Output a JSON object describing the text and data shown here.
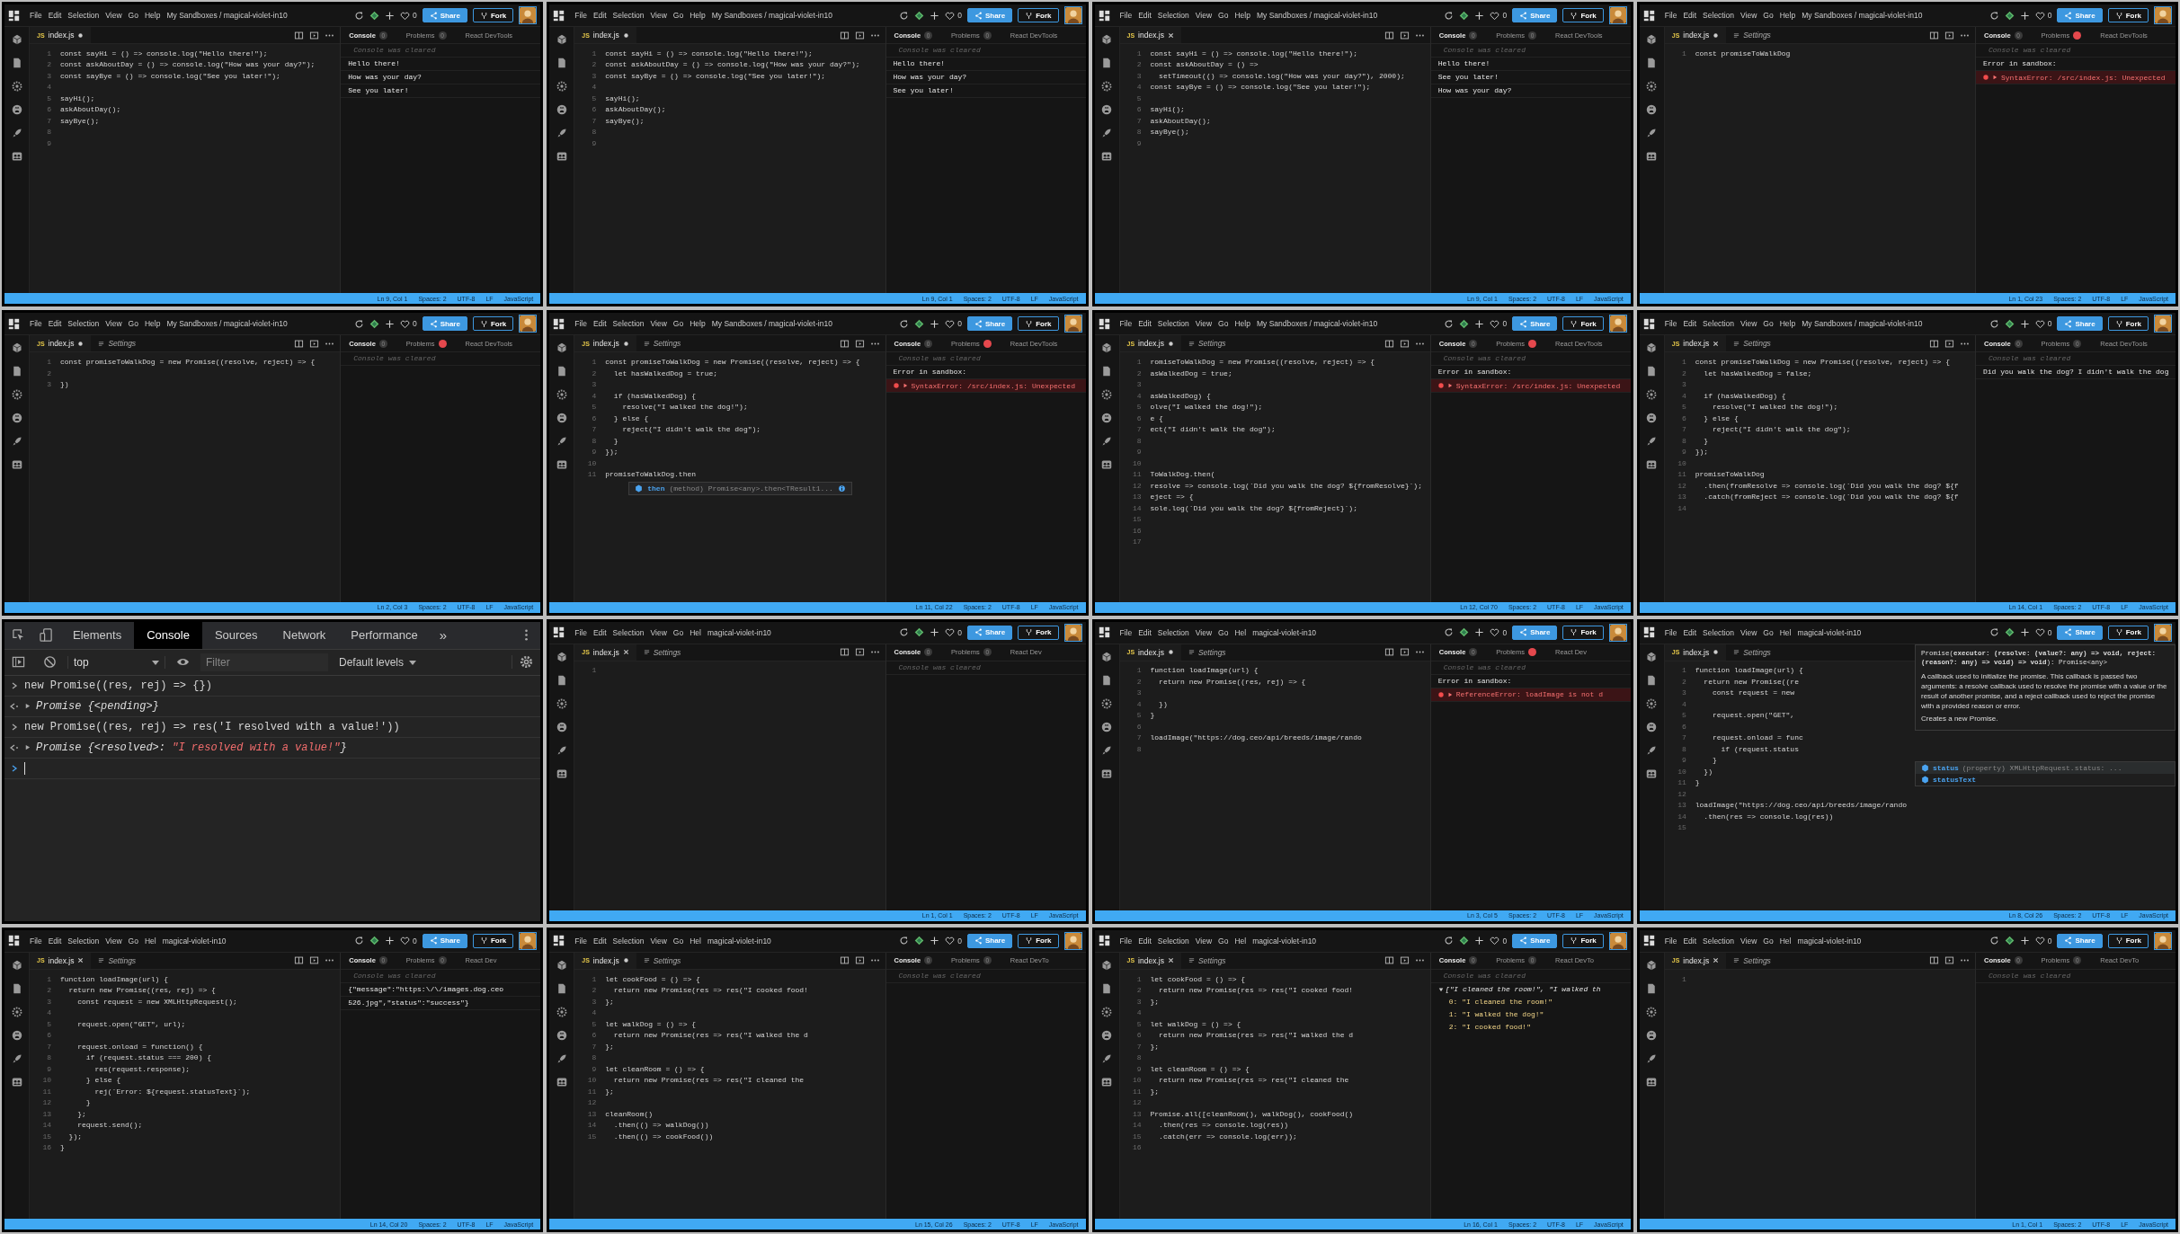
{
  "tiles": [
    {
      "kind": "editor",
      "menu": [
        "File",
        "Edit",
        "Selection",
        "View",
        "Go",
        "Help"
      ],
      "title": "My Sandboxes / magical-violet-in10",
      "likes": "0",
      "share": "Share",
      "fork": "Fork",
      "tabs": [
        {
          "kind": "file",
          "badge": "JS",
          "label": "index.js",
          "modified": true,
          "selected": true
        }
      ],
      "lines": [
        {
          "number": "1",
          "code": "const sayHi = () => console.log(\"Hello there!\");"
        },
        {
          "number": "2",
          "code": "const askAboutDay = () => console.log(\"How was your day?\");"
        },
        {
          "number": "3",
          "code": "const sayBye = () => console.log(\"See you later!\");"
        },
        {
          "number": "4"
        },
        {
          "number": "5",
          "code": "sayHi();"
        },
        {
          "number": "6",
          "code": "askAboutDay();"
        },
        {
          "number": "7",
          "code": "sayBye();"
        },
        {
          "number": "8"
        },
        {
          "number": "9"
        }
      ],
      "consoleTabs": [
        {
          "label": "Console",
          "count": "0",
          "error": false,
          "selected": true
        },
        {
          "label": "Problems",
          "count": "0",
          "error": false,
          "selected": false
        },
        {
          "label": "React DevTools",
          "selected": false
        }
      ],
      "console": [
        {
          "kind": "cleared",
          "text": "Console was cleared"
        },
        {
          "kind": "log",
          "text": "Hello there!"
        },
        {
          "kind": "log",
          "text": "How was your day?"
        },
        {
          "kind": "log",
          "text": "See you later!"
        }
      ],
      "status": [
        "Ln 9, Col 1",
        "Spaces: 2",
        "UTF-8",
        "LF",
        "JavaScript"
      ]
    },
    {
      "kind": "editor",
      "menu": [
        "File",
        "Edit",
        "Selection",
        "View",
        "Go",
        "Help"
      ],
      "title": "My Sandboxes / magical-violet-in10",
      "likes": "0",
      "share": "Share",
      "fork": "Fork",
      "tabs": [
        {
          "kind": "file",
          "badge": "JS",
          "label": "index.js",
          "modified": true,
          "selected": true
        }
      ],
      "lines": [
        {
          "number": "1",
          "code": "const sayHi = () => console.log(\"Hello there!\");"
        },
        {
          "number": "2",
          "code": "const askAboutDay = () => console.log(\"How was your day?\");"
        },
        {
          "number": "3",
          "code": "const sayBye = () => console.log(\"See you later!\");"
        },
        {
          "number": "4"
        },
        {
          "number": "5",
          "code": "sayHi();"
        },
        {
          "number": "6",
          "code": "askAboutDay();"
        },
        {
          "number": "7",
          "code": "sayBye();"
        },
        {
          "number": "8"
        },
        {
          "number": "9"
        }
      ],
      "consoleTabs": [
        {
          "label": "Console",
          "count": "0",
          "error": false,
          "selected": true
        },
        {
          "label": "Problems",
          "count": "0",
          "error": false,
          "selected": false
        },
        {
          "label": "React DevTools",
          "selected": false
        }
      ],
      "console": [
        {
          "kind": "cleared",
          "text": "Console was cleared"
        },
        {
          "kind": "log",
          "text": "Hello there!"
        },
        {
          "kind": "log",
          "text": "How was your day?"
        },
        {
          "kind": "log",
          "text": "See you later!"
        }
      ],
      "status": [
        "Ln 9, Col 1",
        "Spaces: 2",
        "UTF-8",
        "LF",
        "JavaScript"
      ]
    },
    {
      "kind": "editor",
      "menu": [
        "File",
        "Edit",
        "Selection",
        "View",
        "Go",
        "Help"
      ],
      "title": "My Sandboxes / magical-violet-in10",
      "likes": "0",
      "share": "Share",
      "fork": "Fork",
      "tabs": [
        {
          "kind": "file",
          "badge": "JS",
          "label": "index.js",
          "modified": false,
          "selected": true
        }
      ],
      "lines": [
        {
          "number": "1",
          "code": "const sayHi = () => console.log(\"Hello there!\");"
        },
        {
          "number": "2",
          "code": "const askAboutDay = () =>"
        },
        {
          "number": "3",
          "code": "  setTimeout(() => console.log(\"How was your day?\"), 2000);"
        },
        {
          "number": "4",
          "code": "const sayBye = () => console.log(\"See you later!\");"
        },
        {
          "number": "5"
        },
        {
          "number": "6",
          "code": "sayHi();"
        },
        {
          "number": "7",
          "code": "askAboutDay();"
        },
        {
          "number": "8",
          "code": "sayBye();"
        },
        {
          "number": "9"
        }
      ],
      "consoleTabs": [
        {
          "label": "Console",
          "count": "0",
          "error": false,
          "selected": true
        },
        {
          "label": "Problems",
          "count": "0",
          "error": false,
          "selected": false
        },
        {
          "label": "React DevTools",
          "selected": false
        }
      ],
      "console": [
        {
          "kind": "cleared",
          "text": "Console was cleared"
        },
        {
          "kind": "log",
          "text": "Hello there!"
        },
        {
          "kind": "log",
          "text": "See you later!"
        },
        {
          "kind": "log",
          "text": "How was your day?"
        }
      ],
      "status": [
        "Ln 9, Col 1",
        "Spaces: 2",
        "UTF-8",
        "LF",
        "JavaScript"
      ]
    },
    {
      "kind": "editor",
      "menu": [
        "File",
        "Edit",
        "Selection",
        "View",
        "Go",
        "Help"
      ],
      "title": "My Sandboxes / magical-violet-in10",
      "likes": "0",
      "share": "Share",
      "fork": "Fork",
      "tabs": [
        {
          "kind": "file",
          "badge": "JS",
          "label": "index.js",
          "modified": true,
          "selected": true
        },
        {
          "kind": "settings",
          "label": "Settings",
          "selected": false
        }
      ],
      "lines": [
        {
          "number": "1",
          "code": "const promiseToWalkDog"
        }
      ],
      "consoleTabs": [
        {
          "label": "Console",
          "count": "0",
          "error": false,
          "selected": true
        },
        {
          "label": "Problems",
          "error": true,
          "selected": false
        },
        {
          "label": "React DevTools",
          "selected": false
        }
      ],
      "console": [
        {
          "kind": "cleared",
          "text": "Console was cleared"
        },
        {
          "kind": "error-title",
          "text": "Error in sandbox:"
        },
        {
          "kind": "error",
          "text": "SyntaxError: /src/index.js: Unexpected"
        }
      ],
      "status": [
        "Ln 1, Col 23",
        "Spaces: 2",
        "UTF-8",
        "LF",
        "JavaScript"
      ]
    },
    {
      "kind": "editor",
      "menu": [
        "File",
        "Edit",
        "Selection",
        "View",
        "Go",
        "Help"
      ],
      "title": "My Sandboxes / magical-violet-in10",
      "likes": "0",
      "share": "Share",
      "fork": "Fork",
      "tabs": [
        {
          "kind": "file",
          "badge": "JS",
          "label": "index.js",
          "modified": true,
          "selected": true
        },
        {
          "kind": "settings",
          "label": "Settings",
          "selected": false
        }
      ],
      "lines": [
        {
          "number": "1",
          "code": "const promiseToWalkDog = new Promise((resolve, reject) => {"
        },
        {
          "number": "2"
        },
        {
          "number": "3",
          "code": "})"
        }
      ],
      "consoleTabs": [
        {
          "label": "Console",
          "count": "0",
          "error": false,
          "selected": true
        },
        {
          "label": "Problems",
          "error": true,
          "selected": false
        },
        {
          "label": "React DevTools",
          "selected": false
        }
      ],
      "console": [
        {
          "kind": "cleared",
          "text": "Console was cleared"
        }
      ],
      "status": [
        "Ln 2, Col 3",
        "Spaces: 2",
        "UTF-8",
        "LF",
        "JavaScript"
      ]
    },
    {
      "kind": "editor",
      "menu": [
        "File",
        "Edit",
        "Selection",
        "View",
        "Go",
        "Help"
      ],
      "title": "My Sandboxes / magical-violet-in10",
      "likes": "0",
      "share": "Share",
      "fork": "Fork",
      "tabs": [
        {
          "kind": "file",
          "badge": "JS",
          "label": "index.js",
          "modified": true,
          "selected": true
        },
        {
          "kind": "settings",
          "label": "Settings",
          "selected": false
        }
      ],
      "lines": [
        {
          "number": "1",
          "code": "const promiseToWalkDog = new Promise((resolve, reject) => {"
        },
        {
          "number": "2",
          "code": "  let hasWalkedDog = true;"
        },
        {
          "number": "3"
        },
        {
          "number": "4",
          "code": "  if (hasWalkedDog) {"
        },
        {
          "number": "5",
          "code": "    resolve(\"I walked the dog!\");"
        },
        {
          "number": "6",
          "code": "  } else {"
        },
        {
          "number": "7",
          "code": "    reject(\"I didn't walk the dog\");"
        },
        {
          "number": "8",
          "code": "  }"
        },
        {
          "number": "9",
          "code": "});"
        },
        {
          "number": "10"
        },
        {
          "number": "11",
          "code": "promiseToWalkDog.then"
        }
      ],
      "autocomplete": {
        "label": "then",
        "detail": "(method) Promise<any>.then<TResult1..."
      },
      "consoleTabs": [
        {
          "label": "Console",
          "count": "0",
          "error": false,
          "selected": true
        },
        {
          "label": "Problems",
          "error": true,
          "selected": false
        },
        {
          "label": "React DevTools",
          "selected": false
        }
      ],
      "console": [
        {
          "kind": "cleared",
          "text": "Console was cleared"
        },
        {
          "kind": "error-title",
          "text": "Error in sandbox:"
        },
        {
          "kind": "error",
          "text": "SyntaxError: /src/index.js: Unexpected"
        }
      ],
      "status": [
        "Ln 11, Col 22",
        "Spaces: 2",
        "UTF-8",
        "LF",
        "JavaScript"
      ]
    },
    {
      "kind": "editor",
      "menu": [
        "File",
        "Edit",
        "Selection",
        "View",
        "Go",
        "Help"
      ],
      "title": "My Sandboxes / magical-violet-in10",
      "likes": "0",
      "share": "Share",
      "fork": "Fork",
      "tabs": [
        {
          "kind": "file",
          "badge": "JS",
          "label": "index.js",
          "modified": true,
          "selected": true
        },
        {
          "kind": "settings",
          "label": "Settings",
          "selected": false
        }
      ],
      "lines": [
        {
          "number": "1",
          "code": "romiseToWalkDog = new Promise((resolve, reject) => {"
        },
        {
          "number": "2",
          "code": "asWalkedDog = true;"
        },
        {
          "number": "3"
        },
        {
          "number": "4",
          "code": "asWalkedDog) {"
        },
        {
          "number": "5",
          "code": "olve(\"I walked the dog!\");"
        },
        {
          "number": "6",
          "code": "e {"
        },
        {
          "number": "7",
          "code": "ect(\"I didn't walk the dog\");"
        },
        {
          "number": "8"
        },
        {
          "number": "9"
        },
        {
          "number": "10"
        },
        {
          "number": "11",
          "code": "ToWalkDog.then("
        },
        {
          "number": "12",
          "code": "resolve => console.log(`Did you walk the dog? ${fromResolve}`);"
        },
        {
          "number": "13",
          "code": "eject => {"
        },
        {
          "number": "14",
          "code": "sole.log(`Did you walk the dog? ${fromReject}`);"
        },
        {
          "number": "15"
        },
        {
          "number": "16"
        },
        {
          "number": "17"
        }
      ],
      "consoleTabs": [
        {
          "label": "Console",
          "count": "0",
          "error": false,
          "selected": true
        },
        {
          "label": "Problems",
          "error": true,
          "selected": false
        },
        {
          "label": "React DevTools",
          "selected": false
        }
      ],
      "console": [
        {
          "kind": "cleared",
          "text": "Console was cleared"
        },
        {
          "kind": "error-title",
          "text": "Error in sandbox:"
        },
        {
          "kind": "error",
          "text": "SyntaxError: /src/index.js: Unexpected"
        }
      ],
      "status": [
        "Ln 12, Col 70",
        "Spaces: 2",
        "UTF-8",
        "LF",
        "JavaScript"
      ]
    },
    {
      "kind": "editor",
      "menu": [
        "File",
        "Edit",
        "Selection",
        "View",
        "Go",
        "Help"
      ],
      "title": "My Sandboxes / magical-violet-in10",
      "likes": "0",
      "share": "Share",
      "fork": "Fork",
      "tabs": [
        {
          "kind": "file",
          "badge": "JS",
          "label": "index.js",
          "modified": false,
          "selected": true
        },
        {
          "kind": "settings",
          "label": "Settings",
          "selected": false
        }
      ],
      "lines": [
        {
          "number": "1",
          "code": "const promiseToWalkDog = new Promise((resolve, reject) => {"
        },
        {
          "number": "2",
          "code": "  let hasWalkedDog = false;"
        },
        {
          "number": "3"
        },
        {
          "number": "4",
          "code": "  if (hasWalkedDog) {"
        },
        {
          "number": "5",
          "code": "    resolve(\"I walked the dog!\");"
        },
        {
          "number": "6",
          "code": "  } else {"
        },
        {
          "number": "7",
          "code": "    reject(\"I didn't walk the dog\");"
        },
        {
          "number": "8",
          "code": "  }"
        },
        {
          "number": "9",
          "code": "});"
        },
        {
          "number": "10"
        },
        {
          "number": "11",
          "code": "promiseToWalkDog"
        },
        {
          "number": "12",
          "code": "  .then(fromResolve => console.log(`Did you walk the dog? ${f"
        },
        {
          "number": "13",
          "code": "  .catch(fromReject => console.log(`Did you walk the dog? ${f"
        },
        {
          "number": "14"
        }
      ],
      "consoleTabs": [
        {
          "label": "Console",
          "count": "0",
          "error": false,
          "selected": true
        },
        {
          "label": "Problems",
          "count": "0",
          "error": false,
          "selected": false
        },
        {
          "label": "React DevTools",
          "selected": false
        }
      ],
      "console": [
        {
          "kind": "cleared",
          "text": "Console was cleared"
        },
        {
          "kind": "log",
          "text": "Did you walk the dog? I didn't walk the dog"
        }
      ],
      "status": [
        "Ln 14, Col 1",
        "Spaces: 2",
        "UTF-8",
        "LF",
        "JavaScript"
      ]
    },
    {
      "kind": "devtools",
      "tabs": [
        {
          "label": "Elements",
          "selected": false
        },
        {
          "label": "Console",
          "selected": true
        },
        {
          "label": "Sources",
          "selected": false
        },
        {
          "label": "Network",
          "selected": false
        },
        {
          "label": "Performance",
          "selected": false
        }
      ],
      "overflow": "»",
      "context": "top",
      "filter": {
        "placeholder": "Filter"
      },
      "levels": "Default levels",
      "entries": [
        {
          "kind": "input",
          "text": "new Promise((res, rej) => {})"
        },
        {
          "kind": "output",
          "text": "Promise {<pending>}"
        },
        {
          "kind": "input",
          "text": "new Promise((res, rej) => res('I resolved with a value!'))"
        },
        {
          "kind": "output",
          "text": "Promise {<resolved>: ",
          "value": "\"I resolved with a value!\"",
          "suffix": "}"
        }
      ]
    },
    {
      "kind": "editor",
      "menu": [
        "File",
        "Edit",
        "Selection",
        "View",
        "Go",
        "Hel"
      ],
      "title": "magical-violet-in10",
      "likes": "0",
      "share": "Share",
      "fork": "Fork",
      "tabs": [
        {
          "kind": "file",
          "badge": "JS",
          "label": "index.js",
          "modified": false,
          "selected": true
        },
        {
          "kind": "settings",
          "label": "Settings",
          "selected": false
        }
      ],
      "lines": [
        {
          "number": "1"
        }
      ],
      "consoleTabs": [
        {
          "label": "Console",
          "count": "0",
          "error": false,
          "selected": true
        },
        {
          "label": "Problems",
          "count": "0",
          "error": false,
          "selected": false
        },
        {
          "label": "React Dev",
          "selected": false
        }
      ],
      "console": [
        {
          "kind": "cleared",
          "text": "Console was cleared"
        }
      ],
      "status": [
        "Ln 1, Col 1",
        "Spaces: 2",
        "UTF-8",
        "LF",
        "JavaScript"
      ]
    },
    {
      "kind": "editor",
      "menu": [
        "File",
        "Edit",
        "Selection",
        "View",
        "Go",
        "Hel"
      ],
      "title": "magical-violet-in10",
      "likes": "0",
      "share": "Share",
      "fork": "Fork",
      "tabs": [
        {
          "kind": "file",
          "badge": "JS",
          "label": "index.js",
          "modified": true,
          "selected": true
        },
        {
          "kind": "settings",
          "label": "Settings",
          "selected": false
        }
      ],
      "lines": [
        {
          "number": "1",
          "code": "function loadImage(url) {"
        },
        {
          "number": "2",
          "code": "  return new Promise((res, rej) => {"
        },
        {
          "number": "3"
        },
        {
          "number": "4",
          "code": "  })"
        },
        {
          "number": "5",
          "code": "}"
        },
        {
          "number": "6"
        },
        {
          "number": "7",
          "code": "loadImage(\"https://dog.ceo/api/breeds/image/rando"
        },
        {
          "number": "8"
        }
      ],
      "consoleTabs": [
        {
          "label": "Console",
          "count": "0",
          "error": false,
          "selected": true
        },
        {
          "label": "Problems",
          "error": true,
          "selected": false
        },
        {
          "label": "React Dev",
          "selected": false
        }
      ],
      "console": [
        {
          "kind": "cleared",
          "text": "Console was cleared"
        },
        {
          "kind": "error-title",
          "text": "Error in sandbox:"
        },
        {
          "kind": "error",
          "text": "ReferenceError: loadImage is not d"
        }
      ],
      "status": [
        "Ln 3, Col 5",
        "Spaces: 2",
        "UTF-8",
        "LF",
        "JavaScript"
      ]
    },
    {
      "kind": "editor",
      "menu": [
        "File",
        "Edit",
        "Selection",
        "View",
        "Go",
        "Hel"
      ],
      "title": "magical-violet-in10",
      "likes": "0",
      "share": "Share",
      "fork": "Fork",
      "tabs": [
        {
          "kind": "file",
          "badge": "JS",
          "label": "index.js",
          "modified": true,
          "selected": true
        },
        {
          "kind": "settings",
          "label": "Settings",
          "selected": false
        }
      ],
      "lines": [
        {
          "number": "1",
          "code": "function loadImage(url) {"
        },
        {
          "number": "2",
          "code": "  return new Promise((re"
        },
        {
          "number": "3",
          "code": "    const request = new"
        },
        {
          "number": "4"
        },
        {
          "number": "5",
          "code": "    request.open(\"GET\","
        },
        {
          "number": "6"
        },
        {
          "number": "7",
          "code": "    request.onload = func"
        },
        {
          "number": "8",
          "code": "      if (request.status"
        },
        {
          "number": "9",
          "code": "    }"
        },
        {
          "number": "10",
          "code": "  })"
        },
        {
          "number": "11",
          "code": "}"
        },
        {
          "number": "12"
        },
        {
          "number": "13",
          "code": "loadImage(\"https://dog.ceo/api/breeds/image/rando"
        },
        {
          "number": "14",
          "code": "  .then(res => console.log(res))"
        },
        {
          "number": "15"
        }
      ],
      "tooltip": {
        "signature": "Promise(**executor: (resolve: (value?: any) => void, reject: (reason?: any) => void) => void**): Promise<any>",
        "description": "A callback used to initialize the promise. This callback is passed two arguments: a resolve callback used to resolve the promise with a value or the result of another promise, and a reject callback used to reject the promise with a provided reason or error.",
        "summary": "Creates a new Promise."
      },
      "suggestions": [
        {
          "label": "status",
          "detail": "(property) XMLHttpRequest.status: ...",
          "selected": true
        },
        {
          "label": "statusText",
          "selected": false
        }
      ],
      "status": [
        "Ln 8, Col 26",
        "Spaces: 2",
        "UTF-8",
        "LF",
        "JavaScript"
      ]
    },
    {
      "kind": "editor",
      "menu": [
        "File",
        "Edit",
        "Selection",
        "View",
        "Go",
        "Hel"
      ],
      "title": "magical-violet-in10",
      "likes": "0",
      "share": "Share",
      "fork": "Fork",
      "tabs": [
        {
          "kind": "file",
          "badge": "JS",
          "label": "index.js",
          "modified": false,
          "selected": true
        },
        {
          "kind": "settings",
          "label": "Settings",
          "selected": false
        }
      ],
      "lines": [
        {
          "number": "1",
          "code": "function loadImage(url) {"
        },
        {
          "number": "2",
          "code": "  return new Promise((res, rej) => {"
        },
        {
          "number": "3",
          "code": "    const request = new XMLHttpRequest();"
        },
        {
          "number": "4"
        },
        {
          "number": "5",
          "code": "    request.open(\"GET\", url);"
        },
        {
          "number": "6"
        },
        {
          "number": "7",
          "code": "    request.onload = function() {"
        },
        {
          "number": "8",
          "code": "      if (request.status === 200) {"
        },
        {
          "number": "9",
          "code": "        res(request.response);"
        },
        {
          "number": "10",
          "code": "      } else {"
        },
        {
          "number": "11",
          "code": "        rej(`Error: ${request.statusText}`);"
        },
        {
          "number": "12",
          "code": "      }"
        },
        {
          "number": "13",
          "code": "    };"
        },
        {
          "number": "14",
          "code": "    request.send();"
        },
        {
          "number": "15",
          "code": "  });"
        },
        {
          "number": "16",
          "code": "}"
        }
      ],
      "consoleTabs": [
        {
          "label": "Console",
          "count": "0",
          "error": false,
          "selected": true
        },
        {
          "label": "Problems",
          "count": "0",
          "error": false,
          "selected": false
        },
        {
          "label": "React Dev",
          "selected": false
        }
      ],
      "console": [
        {
          "kind": "cleared",
          "text": "Console was cleared"
        },
        {
          "kind": "log",
          "text": "{\"message\":\"https:\\/\\/images.dog.ceo"
        },
        {
          "kind": "log",
          "text": "526.jpg\",\"status\":\"success\"}"
        }
      ],
      "status": [
        "Ln 14, Col 20",
        "Spaces: 2",
        "UTF-8",
        "LF",
        "JavaScript"
      ]
    },
    {
      "kind": "editor",
      "menu": [
        "File",
        "Edit",
        "Selection",
        "View",
        "Go",
        "Hel"
      ],
      "title": "magical-violet-in10",
      "likes": "0",
      "share": "Share",
      "fork": "Fork",
      "tabs": [
        {
          "kind": "file",
          "badge": "JS",
          "label": "index.js",
          "modified": true,
          "selected": true
        },
        {
          "kind": "settings",
          "label": "Settings",
          "selected": false
        }
      ],
      "lines": [
        {
          "number": "1",
          "code": "let cookFood = () => {"
        },
        {
          "number": "2",
          "code": "  return new Promise(res => res(\"I cooked food!"
        },
        {
          "number": "3",
          "code": "};"
        },
        {
          "number": "4"
        },
        {
          "number": "5",
          "code": "let walkDog = () => {"
        },
        {
          "number": "6",
          "code": "  return new Promise(res => res(\"I walked the d"
        },
        {
          "number": "7",
          "code": "};"
        },
        {
          "number": "8"
        },
        {
          "number": "9",
          "code": "let cleanRoom = () => {"
        },
        {
          "number": "10",
          "code": "  return new Promise(res => res(\"I cleaned the"
        },
        {
          "number": "11",
          "code": "};"
        },
        {
          "number": "12"
        },
        {
          "number": "13",
          "code": "cleanRoom()"
        },
        {
          "number": "14",
          "code": "  .then(() => walkDog())"
        },
        {
          "number": "15",
          "code": "  .then(() => cookFood())"
        }
      ],
      "consoleTabs": [
        {
          "label": "Console",
          "count": "0",
          "error": false,
          "selected": true
        },
        {
          "label": "Problems",
          "count": "0",
          "error": false,
          "selected": false
        },
        {
          "label": "React DevTo",
          "selected": false
        }
      ],
      "console": [
        {
          "kind": "cleared",
          "text": "Console was cleared"
        }
      ],
      "status": [
        "Ln 15, Col 26",
        "Spaces: 2",
        "UTF-8",
        "LF",
        "JavaScript"
      ]
    },
    {
      "kind": "editor",
      "menu": [
        "File",
        "Edit",
        "Selection",
        "View",
        "Go",
        "Hel"
      ],
      "title": "magical-violet-in10",
      "likes": "0",
      "share": "Share",
      "fork": "Fork",
      "tabs": [
        {
          "kind": "file",
          "badge": "JS",
          "label": "index.js",
          "modified": false,
          "selected": true
        },
        {
          "kind": "settings",
          "label": "Settings",
          "selected": false
        }
      ],
      "lines": [
        {
          "number": "1",
          "code": "let cookFood = () => {"
        },
        {
          "number": "2",
          "code": "  return new Promise(res => res(\"I cooked food!"
        },
        {
          "number": "3",
          "code": "};"
        },
        {
          "number": "4"
        },
        {
          "number": "5",
          "code": "let walkDog = () => {"
        },
        {
          "number": "6",
          "code": "  return new Promise(res => res(\"I walked the d"
        },
        {
          "number": "7",
          "code": "};"
        },
        {
          "number": "8"
        },
        {
          "number": "9",
          "code": "let cleanRoom = () => {"
        },
        {
          "number": "10",
          "code": "  return new Promise(res => res(\"I cleaned the"
        },
        {
          "number": "11",
          "code": "};"
        },
        {
          "number": "12"
        },
        {
          "number": "13",
          "code": "Promise.all([cleanRoom(), walkDog(), cookFood()"
        },
        {
          "number": "14",
          "code": "  .then(res => console.log(res))"
        },
        {
          "number": "15",
          "code": "  .catch(err => console.log(err));"
        },
        {
          "number": "16"
        }
      ],
      "consoleTabs": [
        {
          "label": "Console",
          "count": "0",
          "error": false,
          "selected": true
        },
        {
          "label": "Problems",
          "count": "0",
          "error": false,
          "selected": false
        },
        {
          "label": "React DevTo",
          "selected": false
        }
      ],
      "console": [
        {
          "kind": "cleared",
          "text": "Console was cleared"
        },
        {
          "kind": "object",
          "text": "[\"I cleaned the room!\", \"I walked th"
        },
        {
          "kind": "prop",
          "text": "0: \"I cleaned the room!\""
        },
        {
          "kind": "prop",
          "text": "1: \"I walked the dog!\""
        },
        {
          "kind": "prop",
          "text": "2: \"I cooked food!\""
        }
      ],
      "status": [
        "Ln 16, Col 1",
        "Spaces: 2",
        "UTF-8",
        "LF",
        "JavaScript"
      ]
    },
    {
      "kind": "editor",
      "menu": [
        "File",
        "Edit",
        "Selection",
        "View",
        "Go",
        "Hel"
      ],
      "title": "magical-violet-in10",
      "likes": "0",
      "share": "Share",
      "fork": "Fork",
      "tabs": [
        {
          "kind": "file",
          "badge": "JS",
          "label": "index.js",
          "modified": false,
          "selected": true
        },
        {
          "kind": "settings",
          "label": "Settings",
          "selected": false
        }
      ],
      "lines": [
        {
          "number": "1"
        }
      ],
      "consoleTabs": [
        {
          "label": "Console",
          "count": "0",
          "error": false,
          "selected": true
        },
        {
          "label": "Problems",
          "count": "0",
          "error": false,
          "selected": false
        },
        {
          "label": "React DevTo",
          "selected": false
        }
      ],
      "console": [
        {
          "kind": "cleared",
          "text": "Console was cleared"
        }
      ],
      "status": [
        "Ln 1, Col 1",
        "Spaces: 2",
        "UTF-8",
        "LF",
        "JavaScript"
      ]
    }
  ]
}
